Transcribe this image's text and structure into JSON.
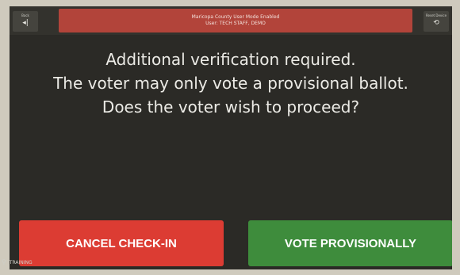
{
  "topbar": {
    "left_button": {
      "caption": "Back",
      "icon": "back-icon",
      "glyph": "◂|"
    },
    "right_button": {
      "caption": "Reset Device",
      "icon": "reset-icon",
      "glyph": "⟲"
    },
    "mode_banner": {
      "line1": "Maricopa County User Mode Enabled",
      "line2": "User: TECH STAFF, DEMO",
      "color": "#b2443a"
    }
  },
  "message": {
    "line1": "Additional verification required.",
    "line2": "The voter may only vote a provisional ballot.",
    "line3": "Does the voter wish to proceed?"
  },
  "actions": {
    "cancel_label": "CANCEL CHECK-IN",
    "cancel_color": "#dc3c33",
    "vote_label": "VOTE PROVISIONALLY",
    "vote_color": "#3e8c3c"
  },
  "footer": {
    "training_label": "TRAINING",
    "training_icon": "location-pin-icon"
  }
}
